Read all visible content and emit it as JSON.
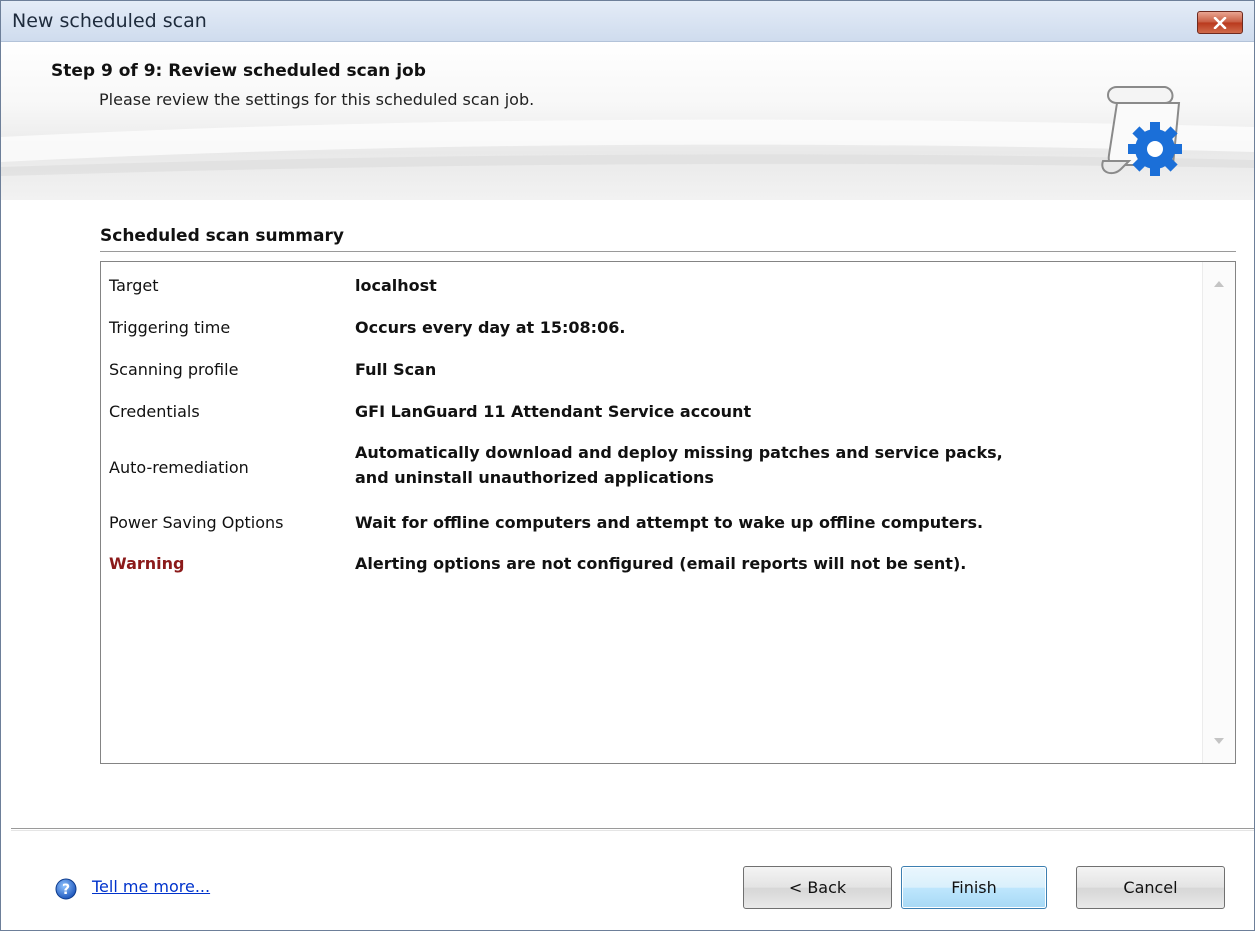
{
  "window": {
    "title": "New scheduled scan"
  },
  "header": {
    "step_title": "Step 9 of 9: Review scheduled scan job",
    "step_description": "Please review the settings for this scheduled scan job.",
    "icon": "scroll-gear-icon"
  },
  "summary": {
    "title": "Scheduled scan summary",
    "rows": [
      {
        "label": "Target",
        "value": "localhost"
      },
      {
        "label": "Triggering time",
        "value": "Occurs every day at 15:08:06."
      },
      {
        "label": "Scanning profile",
        "value": "Full Scan"
      },
      {
        "label": "Credentials",
        "value": "GFI LanGuard 11 Attendant Service account"
      },
      {
        "label": "Auto-remediation",
        "value": "Automatically download and deploy missing patches and service packs,",
        "value_line2": "and uninstall unauthorized applications"
      },
      {
        "label": "Power Saving Options",
        "value": "Wait for offline computers and attempt to wake up offline computers."
      },
      {
        "label": "Warning",
        "value": "Alerting options are not configured (email reports will not be sent)."
      }
    ]
  },
  "footer": {
    "help_link": "Tell me more...",
    "back_label": "< Back",
    "finish_label": "Finish",
    "cancel_label": "Cancel"
  },
  "colors": {
    "warning_label": "#8b1a1a",
    "link": "#0033cc",
    "close_button": "#c75a3f"
  }
}
